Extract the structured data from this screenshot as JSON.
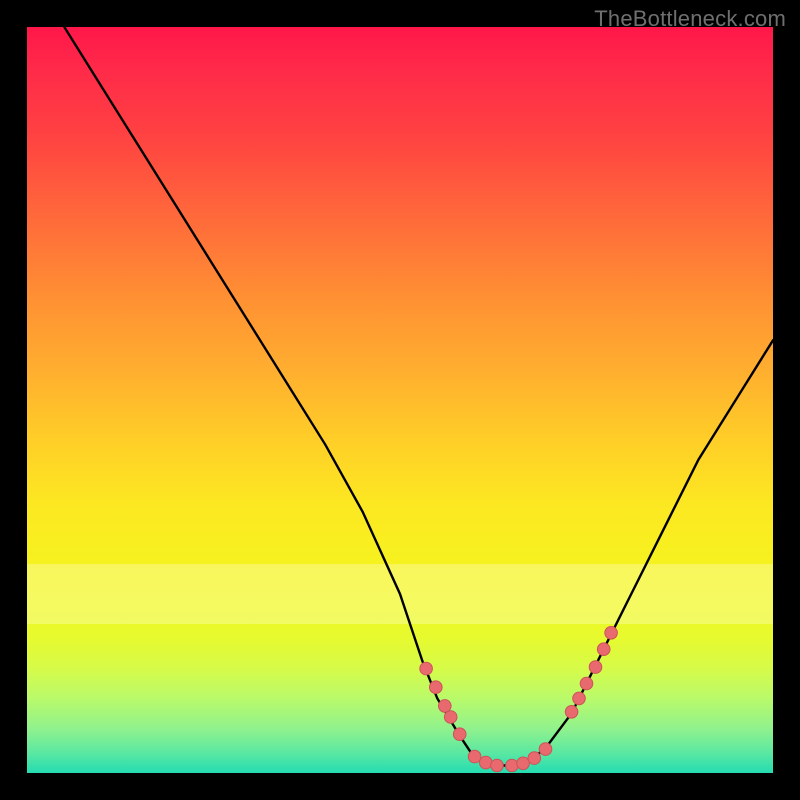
{
  "watermark": "TheBottleneck.com",
  "colors": {
    "page_bg": "#000000",
    "curve": "#000000",
    "marker_fill": "#e86a6e",
    "marker_stroke": "#cc5358",
    "gradient_top": "#ff1749",
    "gradient_bottom": "#24dcb1",
    "watermark": "#6f6f6f"
  },
  "chart_data": {
    "type": "line",
    "title": "",
    "xlabel": "",
    "ylabel": "",
    "xlim": [
      0,
      100
    ],
    "ylim": [
      0,
      100
    ],
    "grid": false,
    "legend": false,
    "series": [
      {
        "name": "bottleneck-curve",
        "x": [
          5,
          10,
          15,
          20,
          25,
          30,
          35,
          40,
          45,
          50,
          53,
          55,
          58,
          60,
          62,
          65,
          68,
          70,
          73,
          76,
          80,
          85,
          90,
          95,
          100
        ],
        "y": [
          100,
          92,
          84,
          76,
          68,
          60,
          52,
          44,
          35,
          24,
          15,
          10,
          5,
          2,
          1,
          1,
          2,
          4,
          8,
          14,
          22,
          32,
          42,
          50,
          58
        ]
      }
    ],
    "markers": {
      "name": "highlighted-points",
      "x": [
        53.5,
        54.8,
        56.0,
        56.8,
        58.0,
        60.0,
        61.5,
        63.0,
        65.0,
        66.5,
        68.0,
        69.5,
        73.0,
        74.0,
        75.0,
        76.2,
        77.3,
        78.3
      ],
      "y": [
        14.0,
        11.5,
        9.0,
        7.5,
        5.2,
        2.2,
        1.4,
        1.0,
        1.0,
        1.3,
        2.0,
        3.2,
        8.2,
        10.0,
        12.0,
        14.2,
        16.6,
        18.8
      ]
    },
    "highlight_band_y": [
      20,
      28
    ]
  }
}
